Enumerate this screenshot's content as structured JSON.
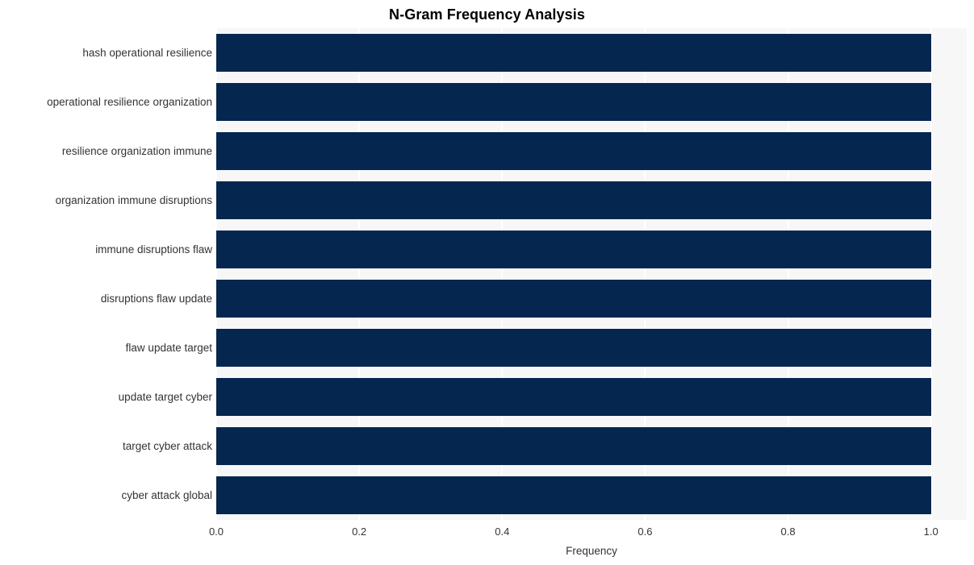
{
  "chart_data": {
    "type": "bar",
    "orientation": "horizontal",
    "title": "N-Gram Frequency Analysis",
    "xlabel": "Frequency",
    "ylabel": "",
    "categories": [
      "hash operational resilience",
      "operational resilience organization",
      "resilience organization immune",
      "organization immune disruptions",
      "immune disruptions flaw",
      "disruptions flaw update",
      "flaw update target",
      "update target cyber",
      "target cyber attack",
      "cyber attack global"
    ],
    "values": [
      1.0,
      1.0,
      1.0,
      1.0,
      1.0,
      1.0,
      1.0,
      1.0,
      1.0,
      1.0
    ],
    "xlim": [
      0.0,
      1.05
    ],
    "xticks": [
      "0.0",
      "0.2",
      "0.4",
      "0.6",
      "0.8",
      "1.0"
    ],
    "xtick_values": [
      0.0,
      0.2,
      0.4,
      0.6,
      0.8,
      1.0
    ],
    "grid": true,
    "grid_axis": "x",
    "legend": false,
    "bar_color": "#04264f",
    "plot_background": "#f7f7f7",
    "grid_color": "#ffffff",
    "text_color": "#333333",
    "title_color": "#000000"
  }
}
